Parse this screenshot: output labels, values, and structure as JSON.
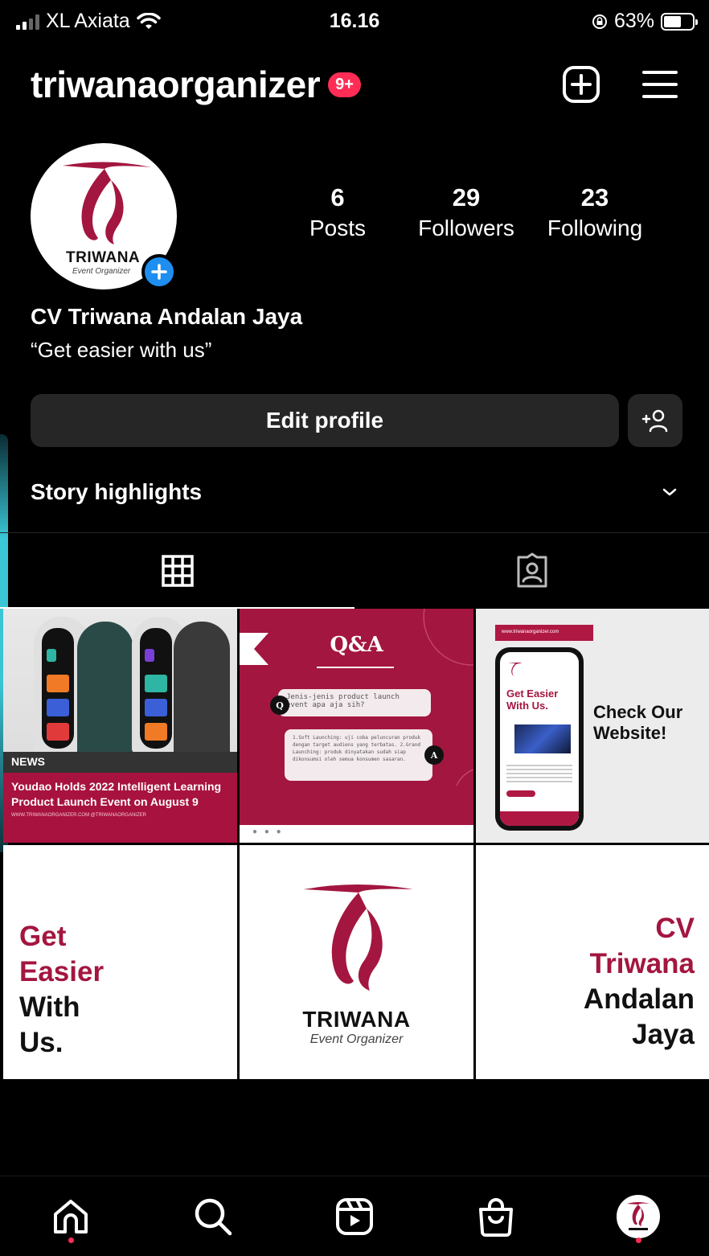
{
  "status_bar": {
    "carrier": "XL Axiata",
    "time": "16.16",
    "battery": "63%"
  },
  "header": {
    "username": "triwanaorganizer",
    "notif_badge": "9+"
  },
  "profile": {
    "avatar_word": "TRIWANA",
    "avatar_sub": "Event Organizer",
    "stats": [
      {
        "value": "6",
        "label": "Posts"
      },
      {
        "value": "29",
        "label": "Followers"
      },
      {
        "value": "23",
        "label": "Following"
      }
    ],
    "full_name": "CV Triwana Andalan Jaya",
    "bio": "“Get easier with us”",
    "edit_button": "Edit profile",
    "story_highlights": "Story highlights"
  },
  "posts": {
    "news": {
      "tag": "NEWS",
      "headline": "Youdao Holds 2022 Intelligent Learning Product Launch Event on August 9",
      "footer": "WWW.TRIWANAORGANIZER.COM   @TRIWANAORGANIZER"
    },
    "qa": {
      "title": "Q&A",
      "question": "Jenis-jenis product launch event apa aja sih?",
      "answer": "1.Soft Launching: uji coba peluncuran produk dengan target audiens yang terbatas. 2.Grand Launching: produk dinyatakan sudah siap dikonsumsi oleh semua konsumen sasaran.",
      "q_badge": "Q",
      "a_badge": "A"
    },
    "website": {
      "url": "www.triwanaorganizer.com",
      "phone_title": "Get Easier With Us.",
      "headline": "Check Our Website!"
    },
    "get_easier": {
      "line1": "Get",
      "line2": "Easier",
      "line3": "With",
      "line4": "Us."
    },
    "logo": {
      "word": "TRIWANA",
      "sub": "Event Organizer"
    },
    "cv": {
      "line1": "CV",
      "line2": "Triwana",
      "line3": "Andalan",
      "line4": "Jaya"
    }
  },
  "colors": {
    "brand_red": "#a3163f",
    "badge_red": "#ff2d55",
    "add_blue": "#1e8ff0"
  },
  "bottom_nav": [
    "home-icon",
    "search-icon",
    "reels-icon",
    "shop-icon",
    "profile-avatar"
  ]
}
